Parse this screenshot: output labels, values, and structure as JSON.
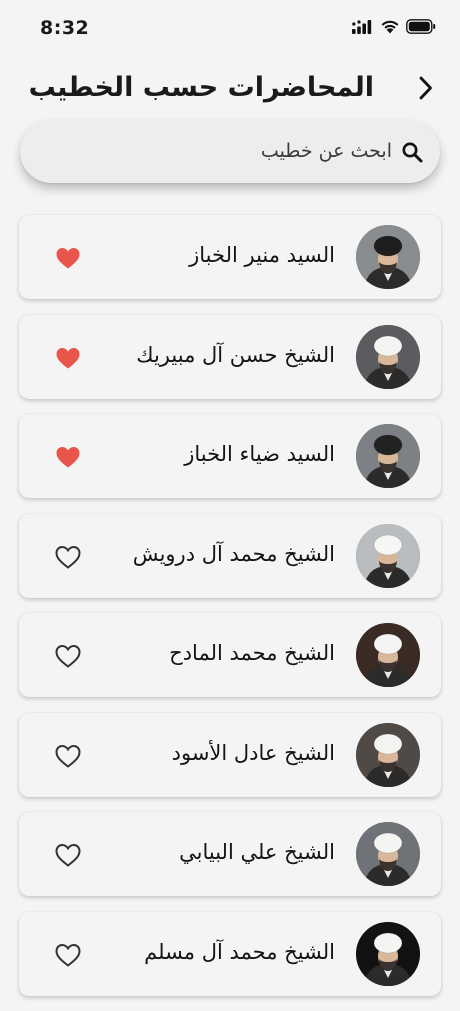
{
  "status_bar": {
    "time": "8:32",
    "icons": [
      "cellular-signal-icon",
      "wifi-icon",
      "battery-icon"
    ]
  },
  "header": {
    "title": "المحاضرات حسب الخطيب",
    "back_icon": "chevron-right-icon"
  },
  "search": {
    "placeholder": "ابحث عن خطيب",
    "value": "",
    "icon": "search-icon"
  },
  "colors": {
    "background": "#f3f5f5",
    "favorite_active": "#e8554a",
    "favorite_inactive": "#333333"
  },
  "speakers": [
    {
      "name": "السيد منير الخباز",
      "favorite": true,
      "avatar_bg": "#8a8d90",
      "turban": "#1e1e1e"
    },
    {
      "name": "الشيخ حسن آل مبيريك",
      "favorite": true,
      "avatar_bg": "#5a5c60",
      "turban": "#f4f4f2"
    },
    {
      "name": "السيد ضياء الخباز",
      "favorite": true,
      "avatar_bg": "#7d8186",
      "turban": "#222222"
    },
    {
      "name": "الشيخ محمد آل درويش",
      "favorite": false,
      "avatar_bg": "#b9bdbf",
      "turban": "#f6f6f4"
    },
    {
      "name": "الشيخ محمد المادح",
      "favorite": false,
      "avatar_bg": "#3a2a24",
      "turban": "#f4f4f2"
    },
    {
      "name": "الشيخ عادل الأسود",
      "favorite": false,
      "avatar_bg": "#4f4a46",
      "turban": "#f4f4f2"
    },
    {
      "name": "الشيخ علي البيابي",
      "favorite": false,
      "avatar_bg": "#6f7378",
      "turban": "#f4f4f2"
    },
    {
      "name": "الشيخ محمد آل مسلم",
      "favorite": false,
      "avatar_bg": "#121212",
      "turban": "#f4f4f2"
    }
  ]
}
